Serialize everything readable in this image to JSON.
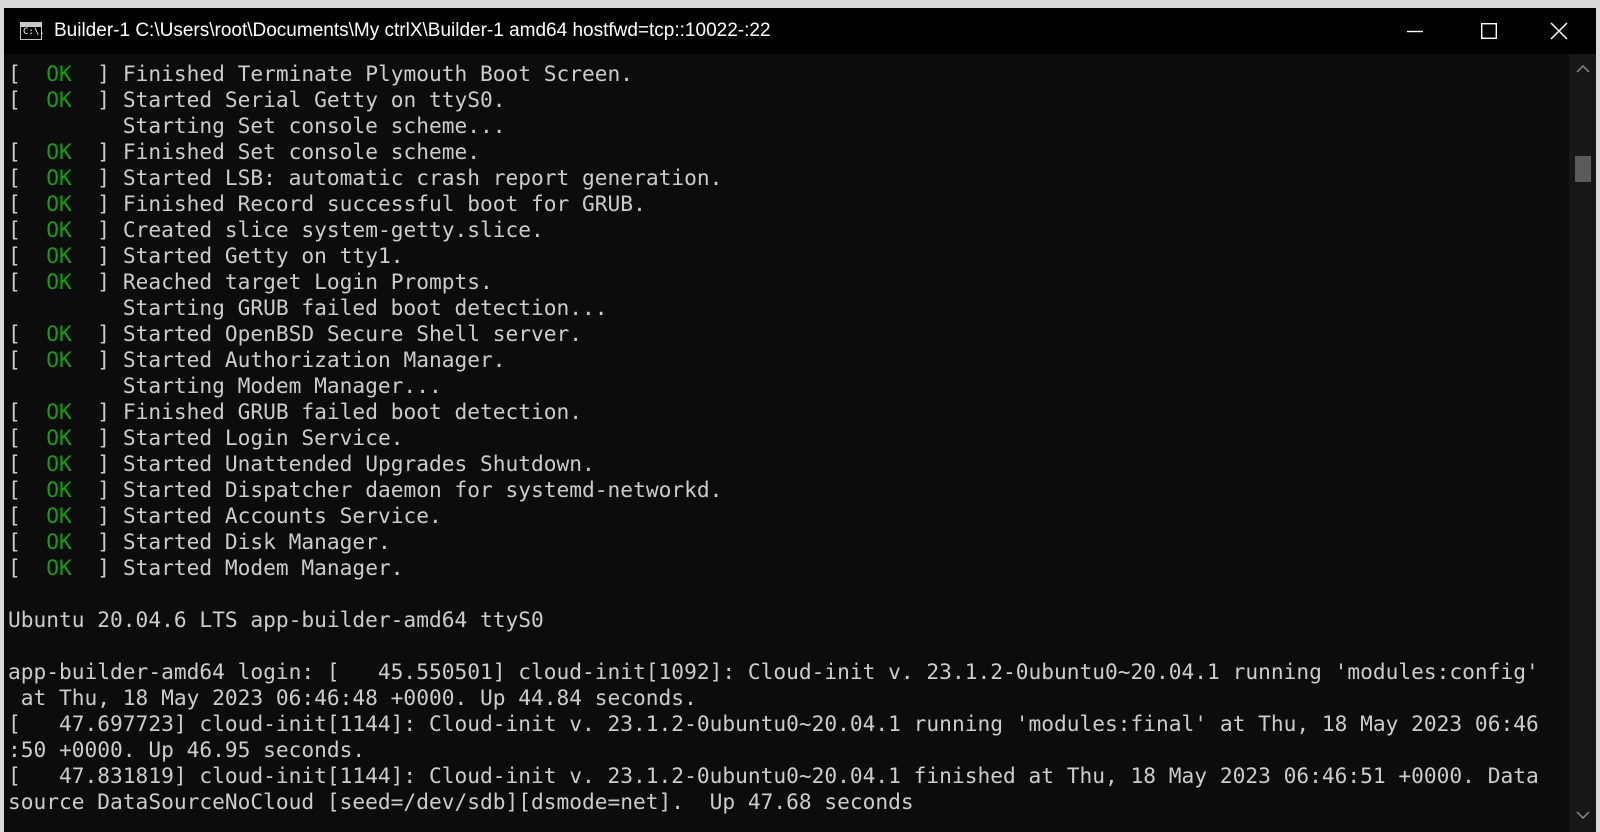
{
  "window": {
    "title": "Builder-1   C:\\Users\\root\\Documents\\My ctrlX\\Builder-1 amd64 hostfwd=tcp::10022-:22",
    "icon_label": "C:\\."
  },
  "colors": {
    "ok": "#13a10e",
    "text": "#cccccc",
    "background": "#0c0c0c"
  },
  "terminal": {
    "lines": [
      {
        "kind": "ok",
        "text": "Finished Terminate Plymouth Boot Screen."
      },
      {
        "kind": "ok",
        "text": "Started Serial Getty on ttyS0."
      },
      {
        "kind": "plain",
        "text": "         Starting Set console scheme..."
      },
      {
        "kind": "ok",
        "text": "Finished Set console scheme."
      },
      {
        "kind": "ok",
        "text": "Started LSB: automatic crash report generation."
      },
      {
        "kind": "ok",
        "text": "Finished Record successful boot for GRUB."
      },
      {
        "kind": "ok",
        "text": "Created slice system-getty.slice."
      },
      {
        "kind": "ok",
        "text": "Started Getty on tty1."
      },
      {
        "kind": "ok",
        "text": "Reached target Login Prompts."
      },
      {
        "kind": "plain",
        "text": "         Starting GRUB failed boot detection..."
      },
      {
        "kind": "ok",
        "text": "Started OpenBSD Secure Shell server."
      },
      {
        "kind": "ok",
        "text": "Started Authorization Manager."
      },
      {
        "kind": "plain",
        "text": "         Starting Modem Manager..."
      },
      {
        "kind": "ok",
        "text": "Finished GRUB failed boot detection."
      },
      {
        "kind": "ok",
        "text": "Started Login Service."
      },
      {
        "kind": "ok",
        "text": "Started Unattended Upgrades Shutdown."
      },
      {
        "kind": "ok",
        "text": "Started Dispatcher daemon for systemd-networkd."
      },
      {
        "kind": "ok",
        "text": "Started Accounts Service."
      },
      {
        "kind": "ok",
        "text": "Started Disk Manager."
      },
      {
        "kind": "ok",
        "text": "Started Modem Manager."
      },
      {
        "kind": "plain",
        "text": ""
      },
      {
        "kind": "plain",
        "text": "Ubuntu 20.04.6 LTS app-builder-amd64 ttyS0"
      },
      {
        "kind": "plain",
        "text": ""
      },
      {
        "kind": "plain",
        "text": "app-builder-amd64 login: [   45.550501] cloud-init[1092]: Cloud-init v. 23.1.2-0ubuntu0~20.04.1 running 'modules:config'"
      },
      {
        "kind": "plain",
        "text": " at Thu, 18 May 2023 06:46:48 +0000. Up 44.84 seconds."
      },
      {
        "kind": "plain",
        "text": "[   47.697723] cloud-init[1144]: Cloud-init v. 23.1.2-0ubuntu0~20.04.1 running 'modules:final' at Thu, 18 May 2023 06:46"
      },
      {
        "kind": "plain",
        "text": ":50 +0000. Up 46.95 seconds."
      },
      {
        "kind": "plain",
        "text": "[   47.831819] cloud-init[1144]: Cloud-init v. 23.1.2-0ubuntu0~20.04.1 finished at Thu, 18 May 2023 06:46:51 +0000. Data"
      },
      {
        "kind": "plain",
        "text": "source DataSourceNoCloud [seed=/dev/sdb][dsmode=net].  Up 47.68 seconds"
      }
    ]
  }
}
